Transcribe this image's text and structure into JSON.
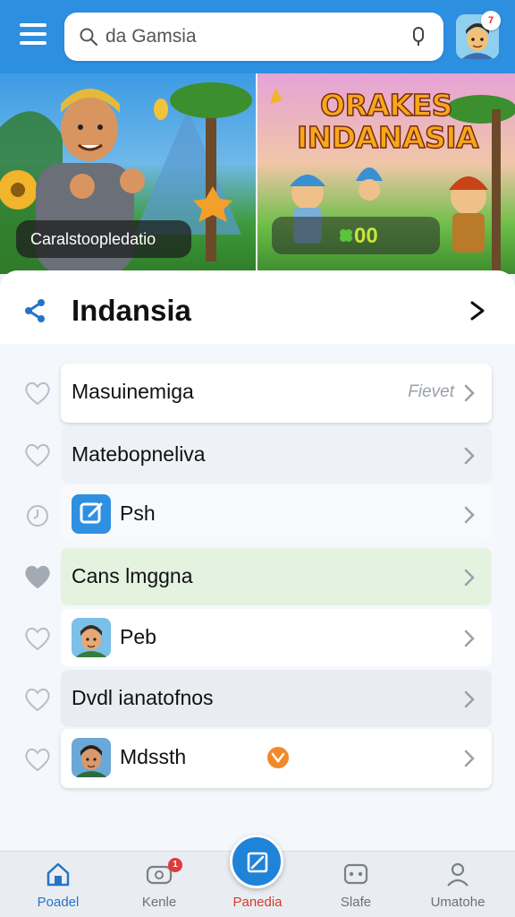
{
  "header": {
    "search_placeholder": "da Gamsia",
    "avatar_badge": "7"
  },
  "banners": [
    {
      "caption": "Caralstoopledatio"
    },
    {
      "title_line1": "ORAKES",
      "title_line2": "INDANASIA",
      "score": "00"
    }
  ],
  "section": {
    "title": "Indansia"
  },
  "list": {
    "items": [
      {
        "label": "Masuinemiga",
        "meta": "Fievet",
        "icon": "none",
        "favorited": false
      },
      {
        "label": "Matebopneliva",
        "meta": "",
        "icon": "none",
        "favorited": false
      },
      {
        "label": "Psh",
        "meta": "",
        "icon": "edit-app-icon",
        "favorited": false
      },
      {
        "label": "Cans lmggna",
        "meta": "",
        "icon": "none",
        "favorited": true
      },
      {
        "label": "Peb",
        "meta": "",
        "icon": "character-app-icon",
        "favorited": false
      },
      {
        "label": "Dvdl ianatofnos",
        "meta": "",
        "icon": "none",
        "favorited": false
      },
      {
        "label": "Mdssth",
        "meta": "",
        "icon": "character-app-icon",
        "favorited": false
      }
    ]
  },
  "bottom_nav": {
    "items": [
      {
        "label": "Poadel",
        "icon": "home-icon",
        "active": true
      },
      {
        "label": "Kenle",
        "icon": "gamepad-icon",
        "badge": "1"
      },
      {
        "label": "Panedia",
        "icon": "edit-icon"
      },
      {
        "label": "Slafe",
        "icon": "controller-icon"
      },
      {
        "label": "Umatohe",
        "icon": "profile-icon"
      }
    ]
  },
  "colors": {
    "header_blue": "#2d8fe0",
    "accent_blue": "#2474c6",
    "highlight_green": "#e3f3e0",
    "highlight_gray": "#e9edf1",
    "badge_red": "#e23a3a"
  }
}
